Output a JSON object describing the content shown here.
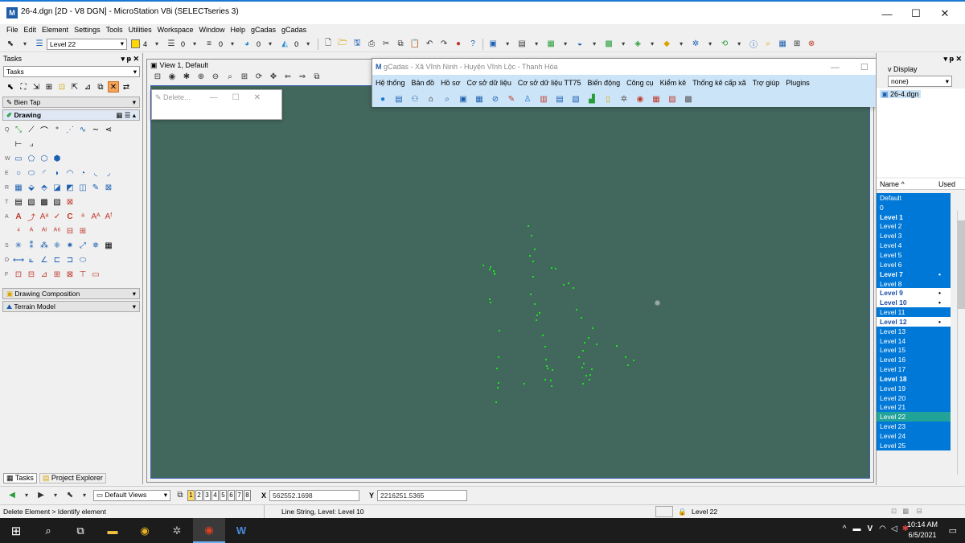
{
  "window": {
    "title": "26-4.dgn [2D - V8 DGN] - MicroStation V8i (SELECTseries 3)",
    "minimize": "—",
    "maximize": "☐",
    "close": "✕"
  },
  "menubar": [
    "File",
    "Edit",
    "Element",
    "Settings",
    "Tools",
    "Utilities",
    "Workspace",
    "Window",
    "Help",
    "gCadas",
    "gCadas"
  ],
  "toolbar": {
    "level": "Level 22",
    "color": "4",
    "style": "0",
    "weight": "0",
    "transparency": "0",
    "priority": "0"
  },
  "tasks": {
    "title": "Tasks",
    "combo": "Tasks",
    "group_bien_tap": "Bien Tap",
    "group_drawing": "Drawing",
    "row_labels": [
      "Q",
      "W",
      "E",
      "R",
      "T",
      "A",
      "S",
      "D",
      "F"
    ],
    "group_drawing_composition": "Drawing Composition",
    "group_terrain_model": "Terrain Model",
    "tab_tasks": "Tasks",
    "tab_project_explorer": "Project Explorer"
  },
  "view": {
    "title": "View 1, Default"
  },
  "delete_dialog": {
    "title": "Delete..."
  },
  "gcadas": {
    "title": "gCadas - Xã Vĩnh Ninh - Huyện Vĩnh Lộc - Thanh Hóa",
    "menu": [
      "Hệ thống",
      "Bản đồ",
      "Hồ sơ",
      "Cơ sở dữ liệu",
      "Cơ sở dữ liệu TT75",
      "Biến động",
      "Công cụ",
      "Kiểm kê",
      "Thống kê cấp xã",
      "Trợ giúp",
      "Plugins"
    ]
  },
  "levels": {
    "display_label": "v Display",
    "none_label": "none)",
    "file": "26-4.dgn",
    "col_name": "Name",
    "col_used": "Used",
    "items": [
      {
        "name": "Default",
        "used": "",
        "style": "blue"
      },
      {
        "name": "0",
        "used": "",
        "style": "blue"
      },
      {
        "name": "Level 1",
        "used": "",
        "style": "blue-bold"
      },
      {
        "name": "Level 2",
        "used": "",
        "style": "blue"
      },
      {
        "name": "Level 3",
        "used": "",
        "style": "blue"
      },
      {
        "name": "Level 4",
        "used": "",
        "style": "blue"
      },
      {
        "name": "Level 5",
        "used": "",
        "style": "blue"
      },
      {
        "name": "Level 6",
        "used": "",
        "style": "blue"
      },
      {
        "name": "Level 7",
        "used": "•",
        "style": "blue-bold"
      },
      {
        "name": "Level 8",
        "used": "",
        "style": "blue"
      },
      {
        "name": "Level 9",
        "used": "•",
        "style": "white-bold"
      },
      {
        "name": "Level 10",
        "used": "•",
        "style": "white-bold"
      },
      {
        "name": "Level 11",
        "used": "",
        "style": "blue"
      },
      {
        "name": "Level 12",
        "used": "•",
        "style": "white-bold"
      },
      {
        "name": "Level 13",
        "used": "",
        "style": "blue"
      },
      {
        "name": "Level 14",
        "used": "",
        "style": "blue"
      },
      {
        "name": "Level 15",
        "used": "",
        "style": "blue"
      },
      {
        "name": "Level 16",
        "used": "",
        "style": "blue"
      },
      {
        "name": "Level 17",
        "used": "",
        "style": "blue"
      },
      {
        "name": "Level 18",
        "used": "",
        "style": "blue-bold"
      },
      {
        "name": "Level 19",
        "used": "",
        "style": "blue"
      },
      {
        "name": "Level 20",
        "used": "",
        "style": "blue"
      },
      {
        "name": "Level 21",
        "used": "",
        "style": "blue"
      },
      {
        "name": "Level 22",
        "used": "",
        "style": "selected"
      },
      {
        "name": "Level 23",
        "used": "",
        "style": "blue"
      },
      {
        "name": "Level 24",
        "used": "",
        "style": "blue"
      },
      {
        "name": "Level 25",
        "used": "",
        "style": "blue"
      }
    ]
  },
  "bottom": {
    "saved_views": "Default Views",
    "views": [
      "1",
      "2",
      "3",
      "4",
      "5",
      "6",
      "7",
      "8"
    ],
    "x_label": "X",
    "x_value": "562552.1698",
    "y_label": "Y",
    "y_value": "2216251.5365"
  },
  "status": {
    "prompt": "Delete Element > Identify element",
    "message": "Line String, Level: Level 10",
    "active_level": "Level 22"
  },
  "taskbar": {
    "time": "10:14 AM",
    "date": "6/5/2021",
    "lang": "V"
  },
  "colors": {
    "canvas": "#42685e",
    "points": "#19e619",
    "level_blue": "#0078d7",
    "level_selected": "#22a39a"
  }
}
